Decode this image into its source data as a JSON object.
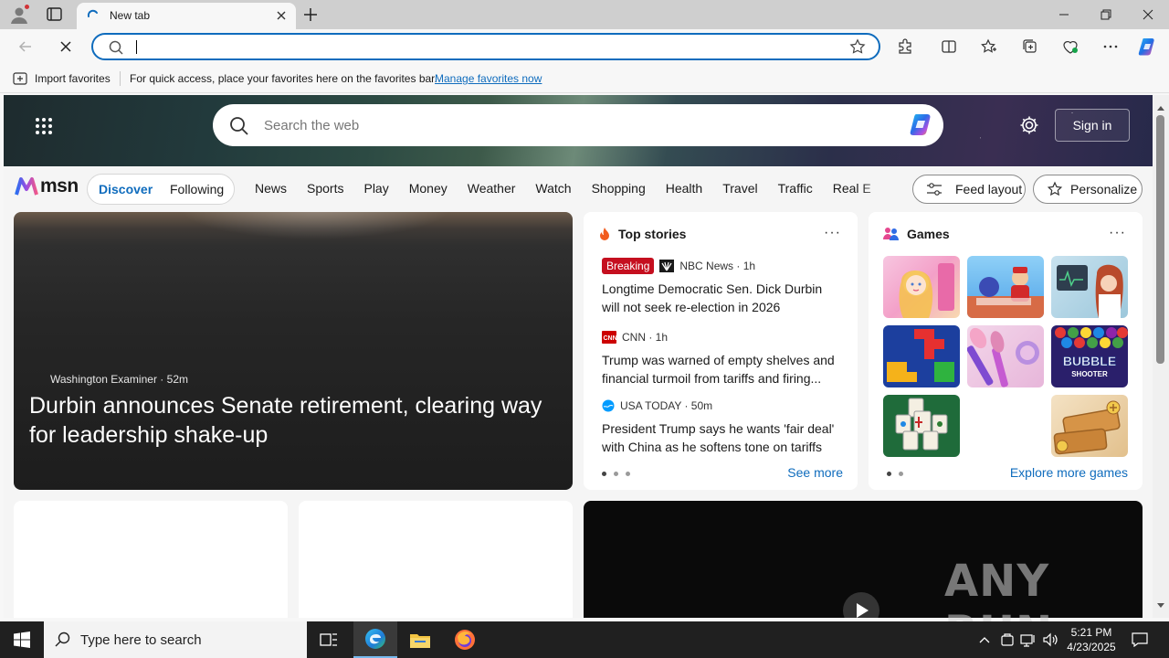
{
  "browser": {
    "tab": {
      "title": "New tab"
    },
    "address": {
      "value": "",
      "placeholder": ""
    },
    "favorites_bar": {
      "import_label": "Import favorites",
      "hint": "For quick access, place your favorites here on the favorites bar.",
      "manage_link": "Manage favorites now"
    }
  },
  "msn": {
    "search_placeholder": "Search the web",
    "signin_label": "Sign in",
    "logo_text": "msn",
    "feed_tabs": [
      {
        "label": "Discover",
        "active": true
      },
      {
        "label": "Following",
        "active": false
      }
    ],
    "nav_links": [
      "News",
      "Sports",
      "Play",
      "Money",
      "Weather",
      "Watch",
      "Shopping",
      "Health",
      "Travel",
      "Traffic",
      "Real E"
    ],
    "feed_layout_label": "Feed layout",
    "personalize_label": "Personalize",
    "featured": {
      "source": "Washington Examiner",
      "age": "52m",
      "headline": "Durbin announces Senate retirement, clearing way for leadership shake-up"
    },
    "top_stories": {
      "heading": "Top stories",
      "breaking_label": "Breaking",
      "stories": [
        {
          "source": "NBC News · 1h",
          "title": "Longtime Democratic Sen. Dick Durbin will not seek re-election in 2026"
        },
        {
          "source": "CNN · 1h",
          "title": "Trump was warned of empty shelves and financial turmoil from tariffs and firing..."
        },
        {
          "source": "USA TODAY · 50m",
          "title": "President Trump says he wants 'fair deal' with China as he softens tone on tariffs"
        }
      ],
      "see_more": "See more"
    },
    "games": {
      "heading": "Games",
      "explore": "Explore more games",
      "tile_labels": [
        "BUBBLE",
        "SHOOTER"
      ]
    }
  },
  "watermark": "ANY RUN",
  "taskbar": {
    "search_placeholder": "Type here to search",
    "time": "5:21 PM",
    "date": "4/23/2025"
  },
  "colors": {
    "accent": "#0f6cbd",
    "breaking": "#c50f1f",
    "taskbar": "#202020"
  }
}
